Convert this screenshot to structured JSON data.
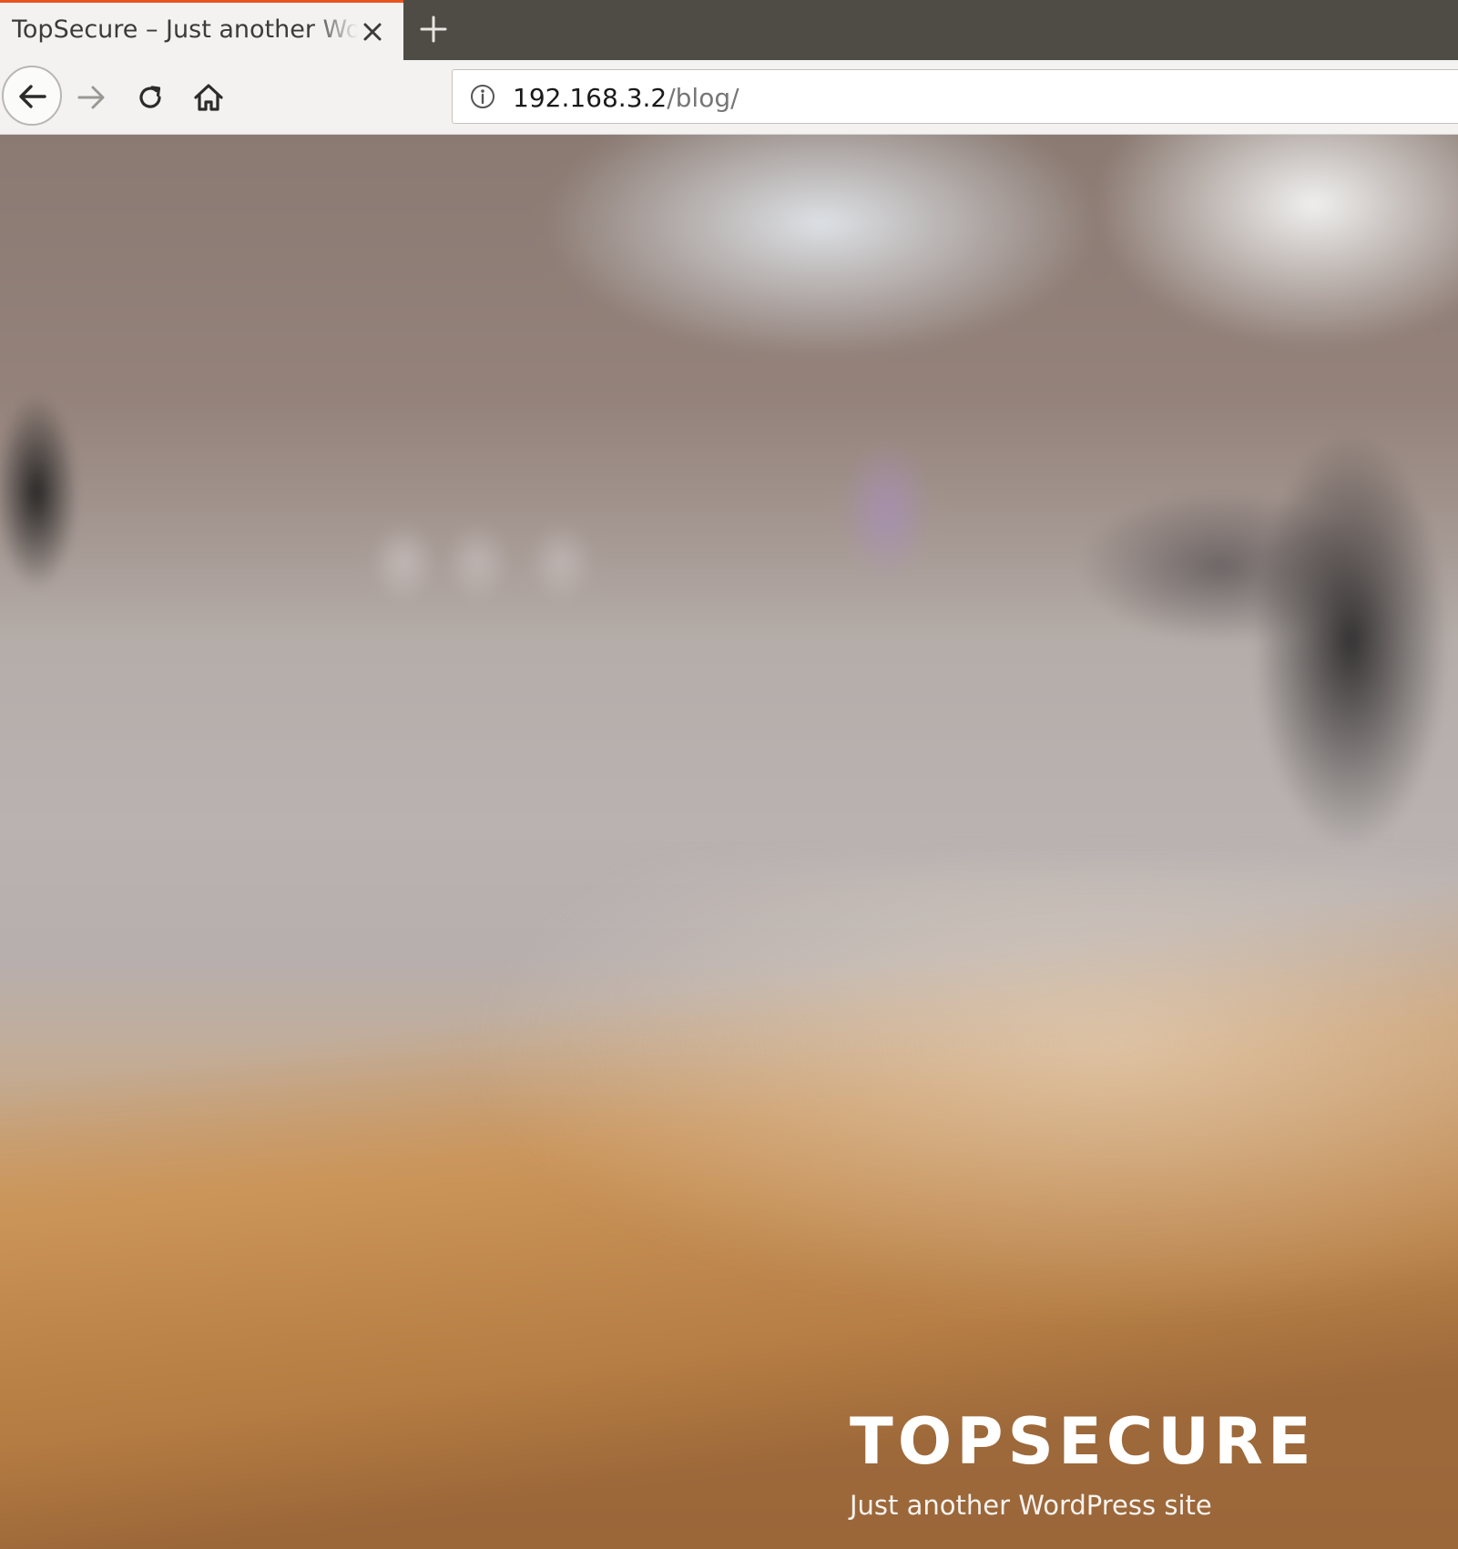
{
  "browser": {
    "tab": {
      "title": "TopSecure – Just another WordPress site",
      "close_icon": "close-icon"
    },
    "new_tab_icon": "plus-icon",
    "nav": {
      "back_icon": "arrow-left-icon",
      "forward_icon": "arrow-right-icon",
      "reload_icon": "reload-icon",
      "home_icon": "home-icon"
    },
    "urlbar": {
      "info_icon": "info-icon",
      "host": "192.168.3.2",
      "path": "/blog/"
    },
    "colors": {
      "tabstrip_bg": "#4f4c46",
      "tab_accent": "#e95420",
      "toolbar_bg": "#f3f2f0"
    }
  },
  "page": {
    "site_title": "TOPSECURE",
    "site_description": "Just another WordPress site"
  }
}
